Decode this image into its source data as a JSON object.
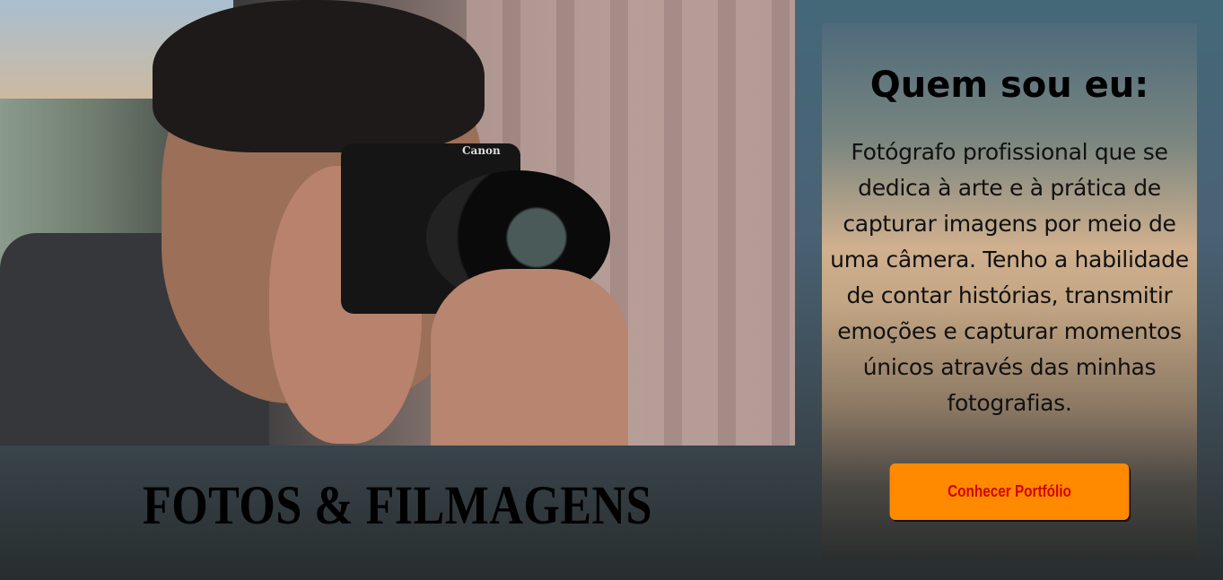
{
  "hero": {
    "title": "FOTOS & FILMAGENS",
    "camera_brand": "Canon"
  },
  "about": {
    "heading": "Quem sou eu:",
    "description": "Fotógrafo profissional que se dedica à arte e à prática de capturar imagens por meio de uma câmera. Tenho a habilidade de contar histórias, transmitir emoções e capturar momentos únicos através das minhas fotografias.",
    "button_label": "Conhecer Portfólio"
  },
  "colors": {
    "button_bg": "#ff8a00",
    "button_text": "#d40000"
  }
}
